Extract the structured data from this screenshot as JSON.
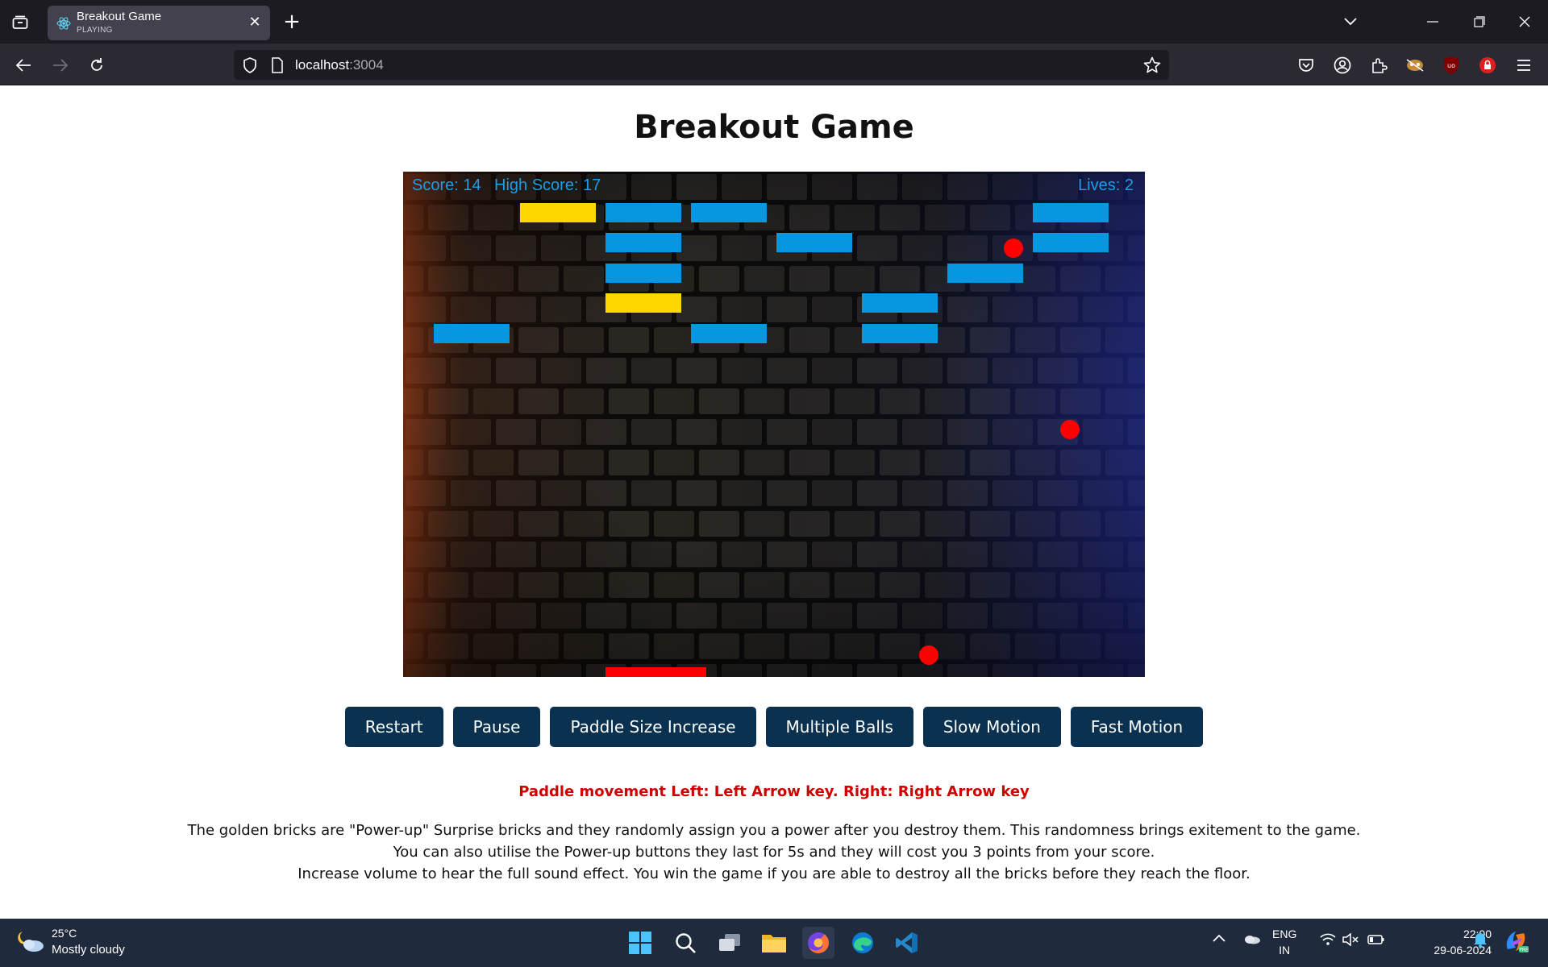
{
  "browser": {
    "tab_title": "Breakout Game",
    "tab_status": "PLAYING",
    "url_host": "localhost",
    "url_port": ":3004"
  },
  "page": {
    "title": "Breakout Game"
  },
  "game": {
    "score_label": "Score: 14",
    "high_score_label": "High Score: 17",
    "lives_label": "Lives: 2",
    "score": 14,
    "high_score": 17,
    "lives": 2,
    "colors": {
      "brick": "#0797e0",
      "powerup_brick": "#ffd700",
      "ball": "#ff0000",
      "paddle": "#ff0000",
      "hud": "#1a9ee6"
    }
  },
  "controls": {
    "restart": "Restart",
    "pause": "Pause",
    "paddle_increase": "Paddle Size Increase",
    "multiple_balls": "Multiple Balls",
    "slow_motion": "Slow Motion",
    "fast_motion": "Fast Motion"
  },
  "instructions": {
    "movement": "Paddle movement Left: Left Arrow key.  Right: Right Arrow key",
    "line1": "The golden bricks are \"Power-up\" Surprise bricks and they randomly assign you a power after you destroy them. This randomness brings exitement to the game.",
    "line2": "You can also utilise the Power-up buttons they last for 5s and they will cost you 3 points from your score.",
    "line3": "Increase volume to hear the full sound effect. You win the game if you are able to destroy all the bricks before they reach the floor."
  },
  "taskbar": {
    "temperature": "25°C",
    "condition": "Mostly cloudy",
    "lang_1": "ENG",
    "lang_2": "IN",
    "time": "22:00",
    "date": "29-06-2024"
  }
}
